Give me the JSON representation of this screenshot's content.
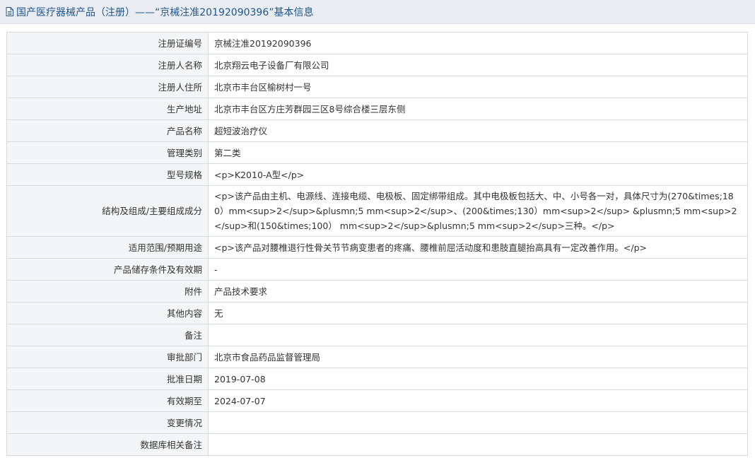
{
  "header": {
    "title": "国产医疗器械产品（注册）——“京械注准20192090396”基本信息",
    "icon": "document-icon",
    "accent_color": "#22568b"
  },
  "rows": [
    {
      "label": "注册证编号",
      "value": "京械注准20192090396"
    },
    {
      "label": "注册人名称",
      "value": "北京翔云电子设备厂有限公司"
    },
    {
      "label": "注册人住所",
      "value": "北京市丰台区榆树村一号"
    },
    {
      "label": "生产地址",
      "value": "北京市丰台区方庄芳群园三区8号综合楼三层东侧"
    },
    {
      "label": "产品名称",
      "value": "超短波治疗仪"
    },
    {
      "label": "管理类别",
      "value": "第二类"
    },
    {
      "label": "型号规格",
      "value": "<p>K2010-A型</p>"
    },
    {
      "label": "结构及组成/主要组成成分",
      "value": "<p>该产品由主机、电源线、连接电缆、电极板、固定绑带组成。其中电极板包括大、中、小号各一对，具体尺寸为(270&times;180）mm<sup>2</sup>&plusmn;5 mm<sup>2</sup>、(200&times;130）mm<sup>2</sup> &plusmn;5 mm<sup>2</sup>和(150&times;100） mm<sup>2</sup>&plusmn;5 mm<sup>2</sup>三种。</p>"
    },
    {
      "label": "适用范围/预期用途",
      "value": "<p>该产品对腰椎退行性骨关节节病变患者的疼痛、腰椎前屈活动度和患肢直腿抬高具有一定改善作用。</p>"
    },
    {
      "label": "产品储存条件及有效期",
      "value": "-"
    },
    {
      "label": "附件",
      "value": "产品技术要求"
    },
    {
      "label": "其他内容",
      "value": "无"
    },
    {
      "label": "备注",
      "value": ""
    },
    {
      "label": "审批部门",
      "value": "北京市食品药品监督管理局"
    },
    {
      "label": "批准日期",
      "value": "2019-07-08"
    },
    {
      "label": "有效期至",
      "value": "2024-07-07"
    },
    {
      "label": "变更情况",
      "value": ""
    },
    {
      "label": "数据库相关备注",
      "value": ""
    }
  ]
}
